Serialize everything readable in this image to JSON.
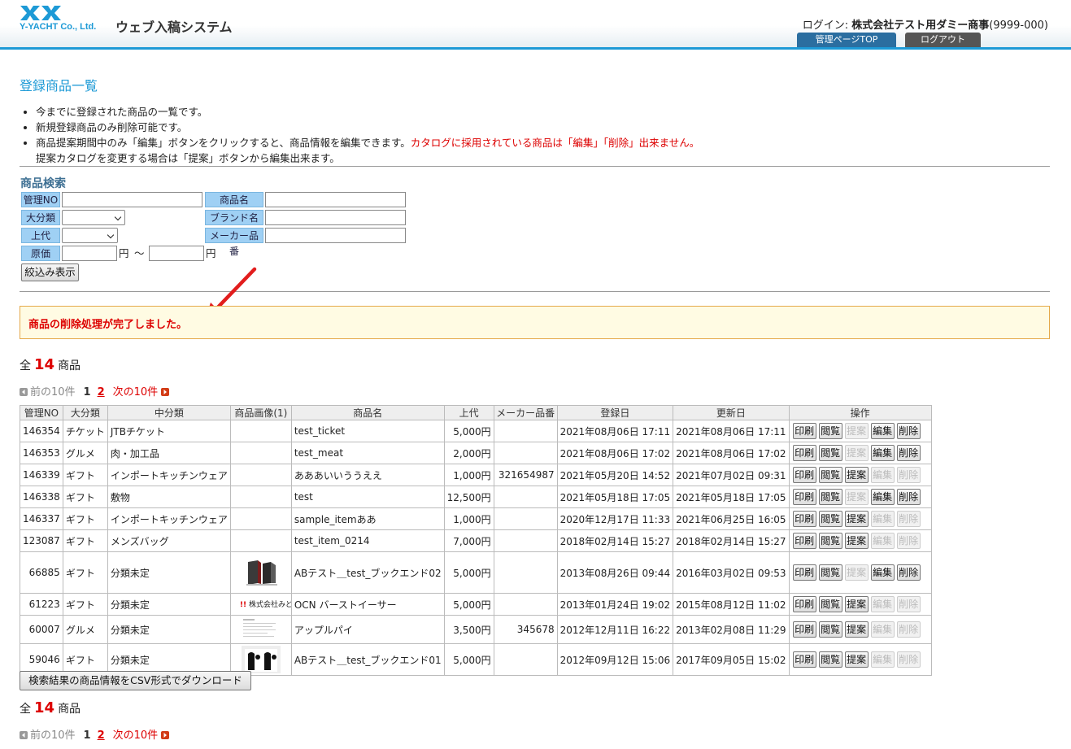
{
  "header": {
    "logo_text": "Y-YACHT Co., Ltd.",
    "system_title": "ウェブ入稿システム",
    "login_label": "ログイン:",
    "login_user": "株式会社テスト用ダミー商事",
    "login_code": "(9999-000)",
    "admin_top_button": "管理ページTOP",
    "logout_button": "ログアウト"
  },
  "page": {
    "title": "登録商品一覧",
    "notes": [
      "今までに登録された商品の一覧です。",
      "新規登録商品のみ削除可能です。"
    ],
    "note3_black": "商品提案期間中のみ「編集」ボタンをクリックすると、商品情報を編集できます。",
    "note3_red": "カタログに採用されている商品は「編集」「削除」出来ません。",
    "note3_line2": "提案カタログを変更する場合は「提案」ボタンから編集出来ます。"
  },
  "search": {
    "title": "商品検索",
    "labels": {
      "mgmt_no": "管理NO",
      "product_name": "商品名",
      "category": "大分類",
      "brand": "ブランド名",
      "price": "上代",
      "maker_code": "メーカー品番",
      "cost": "原価"
    },
    "yen": "円",
    "tilde": "〜",
    "filter_button": "絞込み表示"
  },
  "alert": {
    "message": "商品の削除処理が完了しました。",
    "accent_color": "#d00000"
  },
  "summary": {
    "prefix": "全",
    "count": "14",
    "suffix": "商品"
  },
  "pager": {
    "prev": "前の10件",
    "current": "1",
    "page2": "2",
    "next": "次の10件"
  },
  "table": {
    "headers": [
      "管理NO",
      "大分類",
      "中分類",
      "商品画像(1)",
      "商品名",
      "上代",
      "メーカー品番",
      "登録日",
      "更新日",
      "操作"
    ],
    "op_labels": [
      "印刷",
      "閲覧",
      "提案",
      "編集",
      "削除"
    ],
    "rows": [
      {
        "no": "146354",
        "cat": "チケット",
        "sub": "JTBチケット",
        "img": "",
        "name": "test_ticket",
        "price": "5,000円",
        "maker": "",
        "reg": "2021年08月06日  17:11",
        "upd": "2021年08月06日  17:11",
        "ops": [
          true,
          true,
          false,
          true,
          true
        ]
      },
      {
        "no": "146353",
        "cat": "グルメ",
        "sub": "肉・加工品",
        "img": "",
        "name": "test_meat",
        "price": "2,000円",
        "maker": "",
        "reg": "2021年08月06日  17:02",
        "upd": "2021年08月06日  17:02",
        "ops": [
          true,
          true,
          false,
          true,
          true
        ]
      },
      {
        "no": "146339",
        "cat": "ギフト",
        "sub": "インポートキッチンウェア",
        "img": "",
        "name": "あああいいううええ",
        "price": "1,000円",
        "maker": "321654987",
        "reg": "2021年05月20日  14:52",
        "upd": "2021年07月02日  09:31",
        "ops": [
          true,
          true,
          true,
          false,
          false
        ]
      },
      {
        "no": "146338",
        "cat": "ギフト",
        "sub": "敷物",
        "img": "",
        "name": "test",
        "price": "12,500円",
        "maker": "",
        "reg": "2021年05月18日  17:05",
        "upd": "2021年05月18日  17:05",
        "ops": [
          true,
          true,
          false,
          true,
          true
        ]
      },
      {
        "no": "146337",
        "cat": "ギフト",
        "sub": "インポートキッチンウェア",
        "img": "",
        "name": "sample_itemああ",
        "price": "1,000円",
        "maker": "",
        "reg": "2020年12月17日  11:33",
        "upd": "2021年06月25日  16:05",
        "ops": [
          true,
          true,
          true,
          false,
          false
        ]
      },
      {
        "no": "123087",
        "cat": "ギフト",
        "sub": "メンズバッグ",
        "img": "",
        "name": "test_item_0214",
        "price": "7,000円",
        "maker": "",
        "reg": "2018年02月14日  15:27",
        "upd": "2018年02月14日  15:27",
        "ops": [
          true,
          true,
          true,
          false,
          false
        ]
      },
      {
        "no": "66885",
        "cat": "ギフト",
        "sub": "分類未定",
        "img": "bookend-red",
        "name": "ABテスト＿test_ブックエンド02",
        "price": "5,000円",
        "maker": "",
        "reg": "2013年08月26日  09:44",
        "upd": "2016年03月02日  09:53",
        "ops": [
          true,
          true,
          false,
          true,
          true
        ]
      },
      {
        "no": "61223",
        "cat": "ギフト",
        "sub": "分類未定",
        "img": "logo",
        "name": "OCN バーストイーサー",
        "price": "5,000円",
        "maker": "",
        "reg": "2013年01月24日  19:02",
        "upd": "2015年08月12日  11:02",
        "ops": [
          true,
          true,
          true,
          false,
          false
        ]
      },
      {
        "no": "60007",
        "cat": "グルメ",
        "sub": "分類未定",
        "img": "doc",
        "name": "アップルパイ",
        "price": "3,500円",
        "maker": "345678",
        "reg": "2012年12月11日  16:22",
        "upd": "2013年02月08日  11:29",
        "ops": [
          true,
          true,
          true,
          false,
          false
        ]
      },
      {
        "no": "59046",
        "cat": "ギフト",
        "sub": "分類未定",
        "img": "bookend-bw",
        "name": "ABテスト＿test_ブックエンド01",
        "price": "5,000円",
        "maker": "",
        "reg": "2012年09月12日  15:06",
        "upd": "2017年09月05日  15:02",
        "ops": [
          true,
          true,
          true,
          false,
          false
        ]
      }
    ],
    "logo_thumb_text": "株式会社みどり"
  },
  "csv_button": "検索結果の商品情報をCSV形式でダウンロード"
}
